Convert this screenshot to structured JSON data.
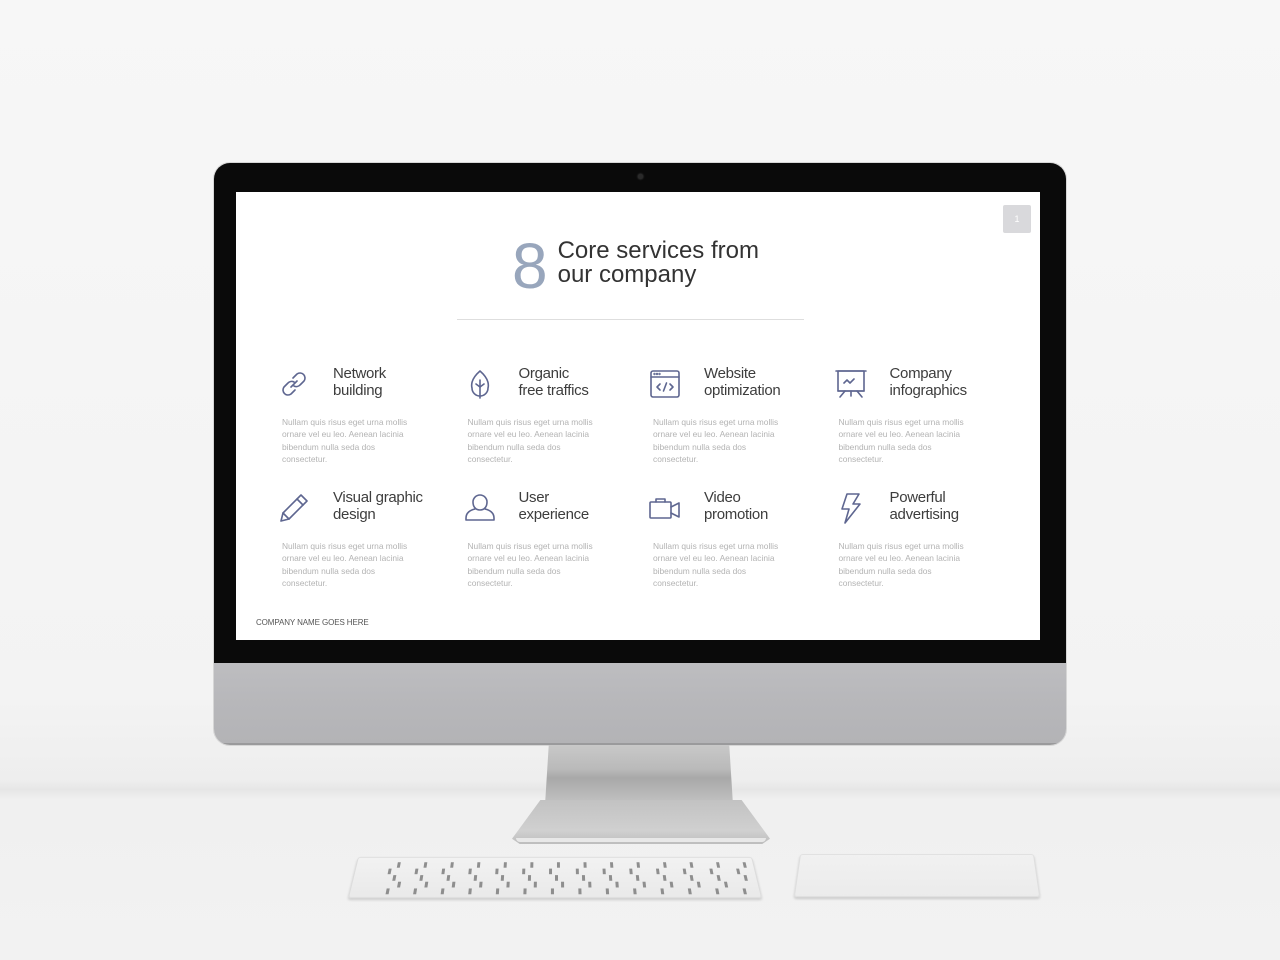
{
  "slide": {
    "page_indicator": "1",
    "title_number": "8",
    "title_line1": "Core services from",
    "title_line2": "our company",
    "footer": "COMPANY NAME GOES HERE",
    "accent_color": "#98a6bc",
    "icon_color": "#5e6690",
    "services": [
      {
        "icon": "link-icon",
        "line1": "Network",
        "line2": "building",
        "desc": "Nullam quis risus eget urna mollis ornare vel eu leo. Aenean lacinia bibendum nulla seda dos consectetur."
      },
      {
        "icon": "leaf-icon",
        "line1": "Organic",
        "line2": "free traffics",
        "desc": "Nullam quis risus eget urna mollis ornare vel eu leo. Aenean lacinia bibendum nulla seda dos consectetur."
      },
      {
        "icon": "code-window-icon",
        "line1": "Website",
        "line2": "optimization",
        "desc": "Nullam quis risus eget urna mollis ornare vel eu leo. Aenean lacinia bibendum nulla seda dos consectetur."
      },
      {
        "icon": "presentation-chart-icon",
        "line1": "Company",
        "line2": "infographics",
        "desc": "Nullam quis risus eget urna mollis ornare vel eu leo. Aenean lacinia bibendum nulla seda dos consectetur."
      },
      {
        "icon": "pencil-icon",
        "line1": "Visual graphic",
        "line2": "design",
        "desc": "Nullam quis risus eget urna mollis ornare vel eu leo. Aenean lacinia bibendum nulla seda dos consectetur."
      },
      {
        "icon": "user-icon",
        "line1": "User",
        "line2": "experience",
        "desc": "Nullam quis risus eget urna mollis ornare vel eu leo. Aenean lacinia bibendum nulla seda dos consectetur."
      },
      {
        "icon": "video-camera-icon",
        "line1": "Video",
        "line2": "promotion",
        "desc": "Nullam quis risus eget urna mollis ornare vel eu leo. Aenean lacinia bibendum nulla seda dos consectetur."
      },
      {
        "icon": "lightning-icon",
        "line1": "Powerful",
        "line2": "advertising",
        "desc": "Nullam quis risus eget urna mollis ornare vel eu leo. Aenean lacinia bibendum nulla seda dos consectetur."
      }
    ]
  }
}
